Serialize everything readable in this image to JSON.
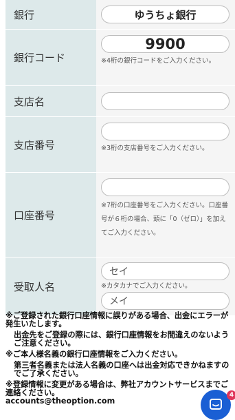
{
  "form": {
    "bank": {
      "label": "銀行",
      "value": "ゆうちょ銀行"
    },
    "bank_code": {
      "label": "銀行コード",
      "value": "9900",
      "hint": "※4桁の銀行コードをご入力ください。"
    },
    "branch_name": {
      "label": "支店名",
      "value": ""
    },
    "branch_number": {
      "label": "支店番号",
      "value": "",
      "hint": "※3桁の支店番号をご入力ください。"
    },
    "account_number": {
      "label": "口座番号",
      "value": "",
      "hint": "※7桁の口座番号をご入力ください。口座番号が６桁の場合、頭に「0（ゼロ）」を加えてご入力ください。"
    },
    "account_holder": {
      "label": "受取人名",
      "last_name_placeholder": "セイ",
      "first_name_placeholder": "メイ",
      "hint": "※カタカナでご入力ください。"
    }
  },
  "notes": {
    "note1": "※ご登録された銀行口座情報に誤りがある場合、出金にエラーが発生いたします。",
    "note1_sub": "出金先をご登録の際には、銀行口座情報をお間違えのないようご注意ください。",
    "note2": "※ご本人様名義の銀行口座情報をご入力ください。",
    "note2_sub": "第三者名義または法人名義の口座へは出金対応できかねますのでご了承ください。",
    "note3": "※登録情報に変更がある場合は、弊社アカウントサービスまでご連絡ください。",
    "email": "accounts@theoption.com"
  },
  "chat": {
    "badge_count": "4"
  },
  "colors": {
    "label_bg": "#dde9ea",
    "field_bg": "#f5f5f5",
    "chat_blue": "#1a5fd4",
    "badge_red": "#e0365a"
  }
}
